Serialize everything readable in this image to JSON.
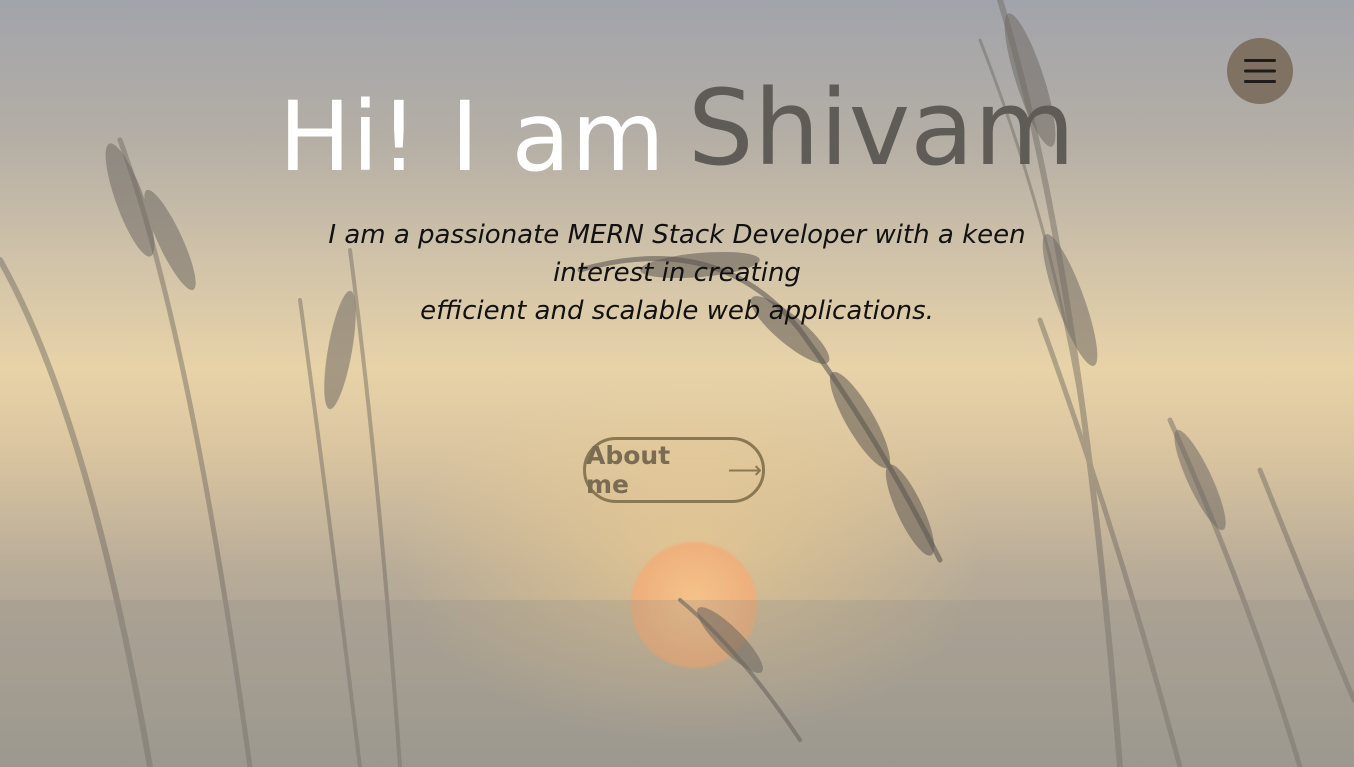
{
  "hero": {
    "greeting": "Hi! I am",
    "name": "Shivam",
    "tagline_line1": "I am a passionate MERN Stack Developer with a keen interest in creating",
    "tagline_line2": "efficient and scalable web applications."
  },
  "about_button": {
    "label": "About me",
    "icon": "arrow-right-icon"
  },
  "menu_button": {
    "icon": "hamburger-menu-icon"
  },
  "colors": {
    "greeting": "#ffffff",
    "name": "#5f5b56",
    "tagline": "#111111",
    "button_border": "#8a7852",
    "menu_bg": "#7f7263"
  }
}
